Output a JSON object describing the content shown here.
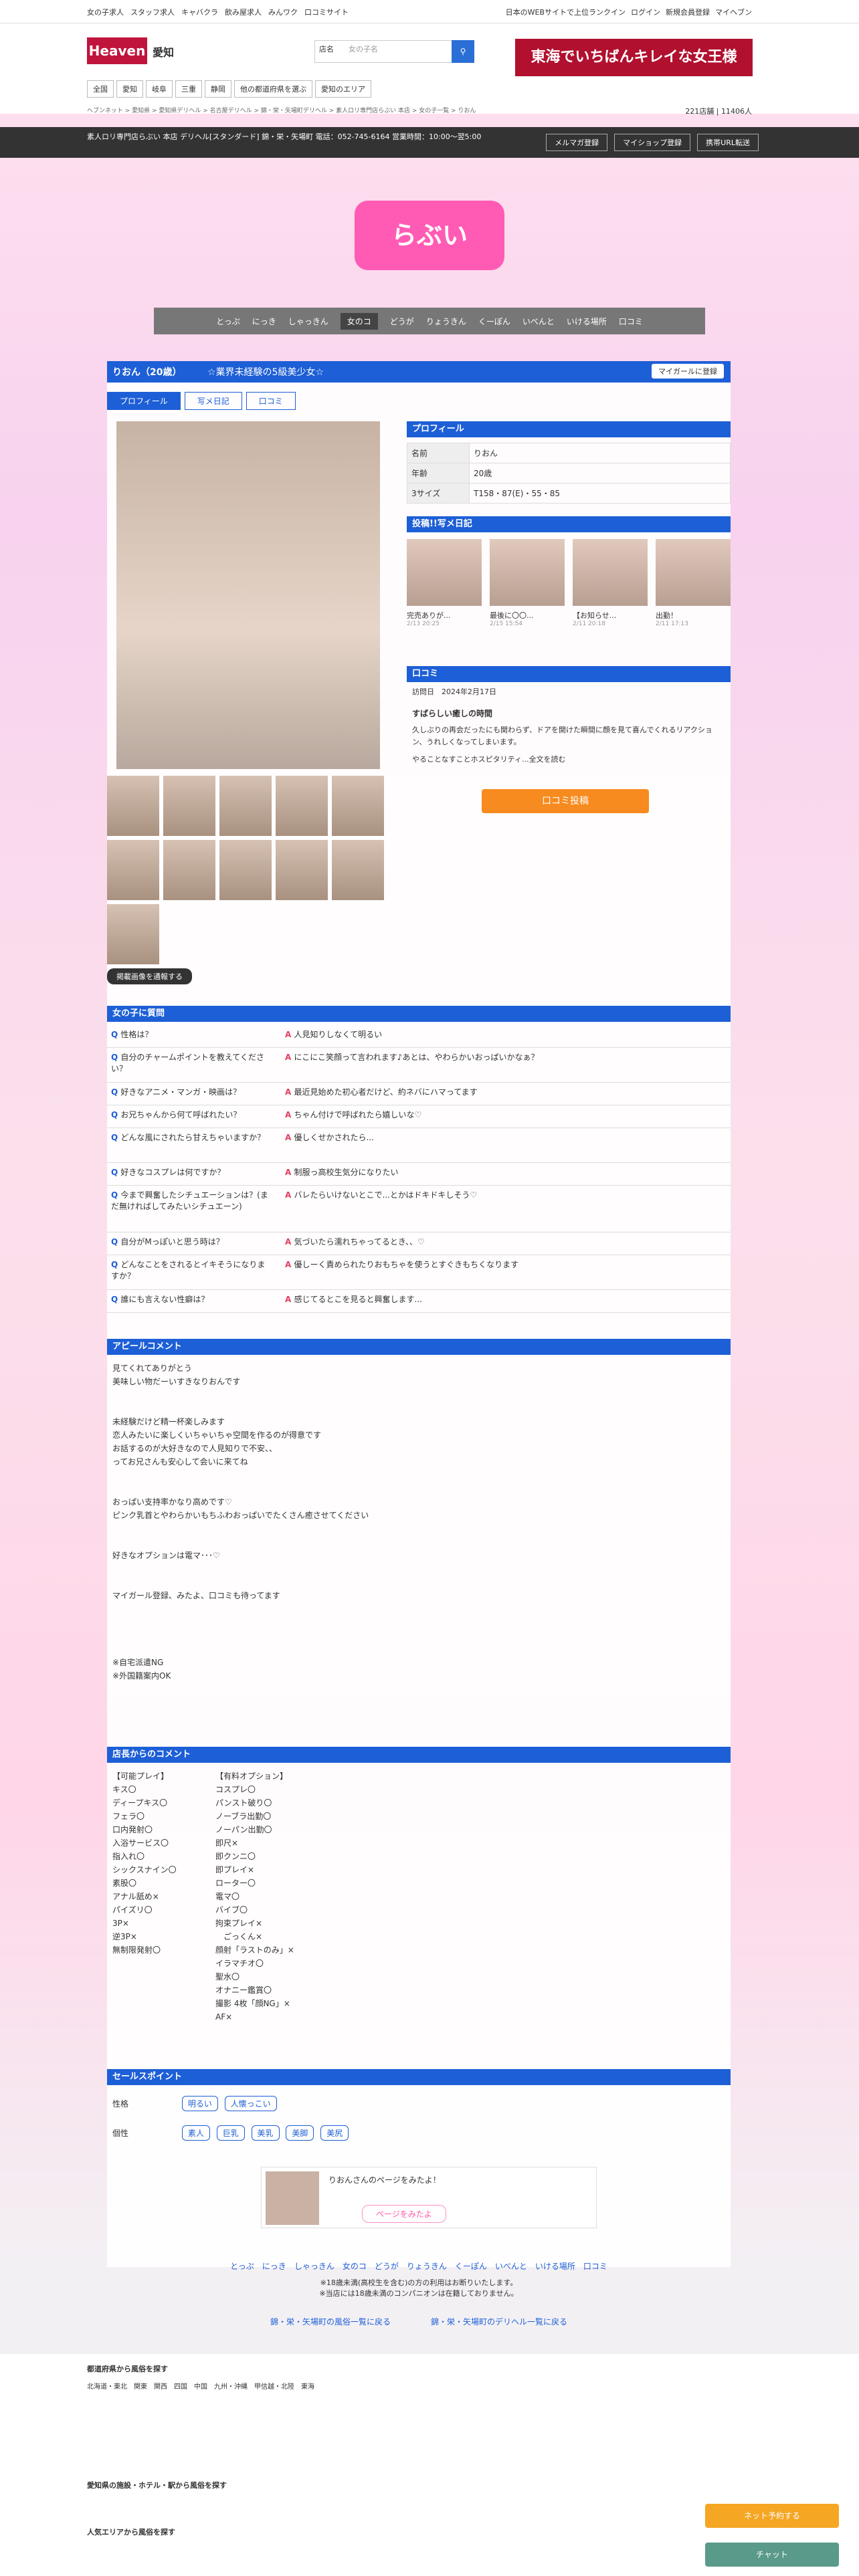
{
  "header": {
    "links": [
      "女の子求人",
      "スタッフ求人",
      "キャバクラ",
      "飲み屋求人",
      "みんワク",
      "口コミサイト"
    ],
    "right": [
      "日本のWEBサイトで上位ランクイン",
      "ログイン",
      "新規会員登録",
      "マイヘブン"
    ],
    "area": "愛知",
    "search_label": "店名",
    "search_placeholder": "女の子名",
    "banner": "東海でいちばんキレイな女王様",
    "nav": [
      "全国",
      "愛知",
      "岐阜",
      "三重",
      "静岡",
      "他の都道府県を選ぶ",
      "愛知のエリア"
    ],
    "crumb": "ヘブンネット > 愛知県 > 愛知県デリヘル > 名古屋デリヘル > 錦・栄・矢場町デリヘル > 素人ロリ専門店らぶい 本店 > 女の子一覧 > りおん",
    "count": "221店舗 | 11406人"
  },
  "shopbar": {
    "text": "素人ロリ専門店らぶい 本店 デリヘル[スタンダード] 錦・栄・矢場町 電話：052-745-6164 営業時間：10:00〜翌5:00",
    "buttons": [
      "メルマガ登録",
      "マイショップ登録",
      "携帯URL転送"
    ]
  },
  "shop_logo": "らぶい",
  "menu": [
    "とっぷ",
    "にっき",
    "しゃっきん",
    "女のコ",
    "どうが",
    "りょうきん",
    "くーぽん",
    "いべんと",
    "いける場所",
    "口コミ"
  ],
  "girl": {
    "name": "りおん（20歳）",
    "catch": "☆業界未経験の5級美少女☆",
    "my_girl": "マイガールに登録",
    "tabs": [
      "プロフィール",
      "写メ日記",
      "口コミ"
    ],
    "more": "掲載画像を通報する"
  },
  "profile": {
    "title": "プロフィール",
    "rows": [
      {
        "k": "名前",
        "v": "りおん"
      },
      {
        "k": "年齢",
        "v": "20歳"
      },
      {
        "k": "3サイズ",
        "v": "T158・87(E)・55・85"
      }
    ]
  },
  "diary": {
    "title": "投稿!!写メ日記",
    "items": [
      {
        "t": "完売ありが...",
        "d": "2/13 20:25"
      },
      {
        "t": "最後に〇〇...",
        "d": "2/15 15:54"
      },
      {
        "t": "【お知らせ...",
        "d": "2/11 20:18"
      },
      {
        "t": "出勤！",
        "d": "2/11 17:13"
      }
    ]
  },
  "review": {
    "title": "口コミ",
    "date": "訪問日　2024年2月17日",
    "heading": "すばらしい癒しの時間",
    "body": "久しぶりの再会だったにも関わらず、ドアを開けた瞬間に顔を見て喜んでくれるリアクション、うれしくなってしまいます。",
    "body2": "やることなすことホスピタリティ...全文を読む",
    "button": "口コミ投稿"
  },
  "qa": {
    "title": "女の子に質問",
    "rows": [
      {
        "q": "性格は？",
        "a": "人見知りしなくて明るい"
      },
      {
        "q": "自分のチャームポイントを教えてください？",
        "a": "にこにこ笑顔って言われます♪あとは、やわらかいおっぱいかなぁ？"
      },
      {
        "q": "好きなアニメ・マンガ・映画は？",
        "a": "最近見始めた初心者だけど、約ネバにハマってます"
      },
      {
        "q": "お兄ちゃんから何て呼ばれたい？",
        "a": "ちゃん付けで呼ばれたら嬉しいな♡"
      },
      {
        "q": "どんな風にされたら甘えちゃいますか？",
        "a": "優しくせかされたら..."
      },
      {
        "q": "好きなコスプレは何ですか？",
        "a": "制服っ高校生気分になりたい"
      },
      {
        "q": "今まで興奮したシチュエーションは？(まだ無ければしてみたいシチュエーン)",
        "a": "バレたらいけないとこで...とかはドキドキしそう♡"
      },
      {
        "q": "自分がMっぽいと思う時は？",
        "a": "気づいたら濡れちゃってるとき、、♡"
      },
      {
        "q": "どんなことをされるとイキそうになりますか？",
        "a": "優しーく責められたりおもちゃを使うとすぐきもちくなります"
      },
      {
        "q": "誰にも言えない性癖は？",
        "a": "感じてるとこを見ると興奮します..."
      }
    ]
  },
  "appeal": {
    "title": "アピールコメント",
    "text": "見てくれてありがとう\n美味しい物だーいすきなりおんです\n\n\n未経験だけど精一杯楽しみます\n恋人みたいに楽しくいちゃいちゃ空間を作るのが得意です\nお話するのが大好きなので人見知りで不安、、\nってお兄さんも安心して会いに来てね\n\n\nおっぱい支持率かなり高めです♡\nピンク乳首とやわらかいもちふわおっぱいでたくさん癒させてください\n\n\n好きなオプションは電マ･･･♡\n\n\nマイガール登録、みたよ、口コミも待ってます\n\n\n\n\n※自宅派遣NG\n※外国籍案内OK"
  },
  "shop_comment": {
    "title": "店長からのコメント",
    "left": "【可能プレイ】\nキス〇\nディープキス〇\nフェラ〇\n口内発射〇\n入浴サービス〇\n指入れ〇\nシックスナイン〇\n素股〇\nアナル舐め×\nパイズリ〇\n3P×\n逆3P×\n無制限発射〇",
    "right": "【有料オプション】\nコスプレ〇\nパンスト破り〇\nノーブラ出勤〇\nノーパン出勤〇\n即尺×\n即クンニ〇\n即プレイ×\nローター〇\n電マ〇\nバイブ〇\n拘束プレイ×\n　ごっくん×\n顔射「ラストのみ」×\nイラマチオ〇\n聖水〇\nオナニー鑑賞〇\n撮影 4枚「顔NG」×\nAF×"
  },
  "sales": {
    "title": "セールスポイント",
    "r1_label": "性格",
    "r1": [
      "明るい",
      "人懐っこい"
    ],
    "r2_label": "個性",
    "r2": [
      "素人",
      "巨乳",
      "美乳",
      "美脚",
      "美尻"
    ]
  },
  "mini_card": {
    "text": "りおんさんのページをみたよ！",
    "button": "ページをみたよ"
  },
  "bottom": {
    "menu": "とっぷ　にっき　しゃっきん　女のコ　どうが　りょうきん　くーぽん　いべんと　いける場所　口コミ",
    "note1": "※18歳未満(高校生を含む)の方の利用はお断りいたします。",
    "note2": "※当店には18歳未満のコンパニオンは在籍しておりません。",
    "link1": "錦・栄・矢場町の風俗一覧に戻る",
    "link2": "錦・栄・矢場町のデリヘル一覧に戻る"
  },
  "footer": {
    "t1": "都道府県から風俗を探す",
    "t2": "愛知県の施設・ホテル・駅から風俗を探す",
    "t3": "人気エリアから風俗を探す",
    "regions": "北海道・東北　関東　関西　四国　中国　九州・沖縄　甲信越・北陸　東海",
    "side1": "ネット予約する",
    "side2": "チャット"
  }
}
